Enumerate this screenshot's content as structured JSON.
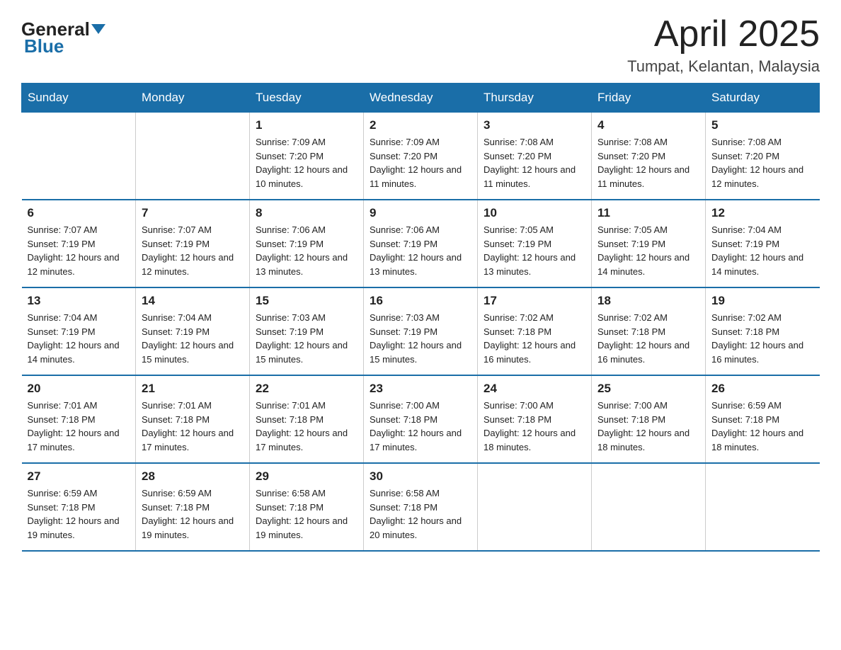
{
  "logo": {
    "general": "General",
    "blue": "Blue"
  },
  "header": {
    "title": "April 2025",
    "subtitle": "Tumpat, Kelantan, Malaysia"
  },
  "days_of_week": [
    "Sunday",
    "Monday",
    "Tuesday",
    "Wednesday",
    "Thursday",
    "Friday",
    "Saturday"
  ],
  "weeks": [
    [
      {
        "day": "",
        "info": ""
      },
      {
        "day": "",
        "info": ""
      },
      {
        "day": "1",
        "info": "Sunrise: 7:09 AM\nSunset: 7:20 PM\nDaylight: 12 hours and 10 minutes."
      },
      {
        "day": "2",
        "info": "Sunrise: 7:09 AM\nSunset: 7:20 PM\nDaylight: 12 hours and 11 minutes."
      },
      {
        "day": "3",
        "info": "Sunrise: 7:08 AM\nSunset: 7:20 PM\nDaylight: 12 hours and 11 minutes."
      },
      {
        "day": "4",
        "info": "Sunrise: 7:08 AM\nSunset: 7:20 PM\nDaylight: 12 hours and 11 minutes."
      },
      {
        "day": "5",
        "info": "Sunrise: 7:08 AM\nSunset: 7:20 PM\nDaylight: 12 hours and 12 minutes."
      }
    ],
    [
      {
        "day": "6",
        "info": "Sunrise: 7:07 AM\nSunset: 7:19 PM\nDaylight: 12 hours and 12 minutes."
      },
      {
        "day": "7",
        "info": "Sunrise: 7:07 AM\nSunset: 7:19 PM\nDaylight: 12 hours and 12 minutes."
      },
      {
        "day": "8",
        "info": "Sunrise: 7:06 AM\nSunset: 7:19 PM\nDaylight: 12 hours and 13 minutes."
      },
      {
        "day": "9",
        "info": "Sunrise: 7:06 AM\nSunset: 7:19 PM\nDaylight: 12 hours and 13 minutes."
      },
      {
        "day": "10",
        "info": "Sunrise: 7:05 AM\nSunset: 7:19 PM\nDaylight: 12 hours and 13 minutes."
      },
      {
        "day": "11",
        "info": "Sunrise: 7:05 AM\nSunset: 7:19 PM\nDaylight: 12 hours and 14 minutes."
      },
      {
        "day": "12",
        "info": "Sunrise: 7:04 AM\nSunset: 7:19 PM\nDaylight: 12 hours and 14 minutes."
      }
    ],
    [
      {
        "day": "13",
        "info": "Sunrise: 7:04 AM\nSunset: 7:19 PM\nDaylight: 12 hours and 14 minutes."
      },
      {
        "day": "14",
        "info": "Sunrise: 7:04 AM\nSunset: 7:19 PM\nDaylight: 12 hours and 15 minutes."
      },
      {
        "day": "15",
        "info": "Sunrise: 7:03 AM\nSunset: 7:19 PM\nDaylight: 12 hours and 15 minutes."
      },
      {
        "day": "16",
        "info": "Sunrise: 7:03 AM\nSunset: 7:19 PM\nDaylight: 12 hours and 15 minutes."
      },
      {
        "day": "17",
        "info": "Sunrise: 7:02 AM\nSunset: 7:18 PM\nDaylight: 12 hours and 16 minutes."
      },
      {
        "day": "18",
        "info": "Sunrise: 7:02 AM\nSunset: 7:18 PM\nDaylight: 12 hours and 16 minutes."
      },
      {
        "day": "19",
        "info": "Sunrise: 7:02 AM\nSunset: 7:18 PM\nDaylight: 12 hours and 16 minutes."
      }
    ],
    [
      {
        "day": "20",
        "info": "Sunrise: 7:01 AM\nSunset: 7:18 PM\nDaylight: 12 hours and 17 minutes."
      },
      {
        "day": "21",
        "info": "Sunrise: 7:01 AM\nSunset: 7:18 PM\nDaylight: 12 hours and 17 minutes."
      },
      {
        "day": "22",
        "info": "Sunrise: 7:01 AM\nSunset: 7:18 PM\nDaylight: 12 hours and 17 minutes."
      },
      {
        "day": "23",
        "info": "Sunrise: 7:00 AM\nSunset: 7:18 PM\nDaylight: 12 hours and 17 minutes."
      },
      {
        "day": "24",
        "info": "Sunrise: 7:00 AM\nSunset: 7:18 PM\nDaylight: 12 hours and 18 minutes."
      },
      {
        "day": "25",
        "info": "Sunrise: 7:00 AM\nSunset: 7:18 PM\nDaylight: 12 hours and 18 minutes."
      },
      {
        "day": "26",
        "info": "Sunrise: 6:59 AM\nSunset: 7:18 PM\nDaylight: 12 hours and 18 minutes."
      }
    ],
    [
      {
        "day": "27",
        "info": "Sunrise: 6:59 AM\nSunset: 7:18 PM\nDaylight: 12 hours and 19 minutes."
      },
      {
        "day": "28",
        "info": "Sunrise: 6:59 AM\nSunset: 7:18 PM\nDaylight: 12 hours and 19 minutes."
      },
      {
        "day": "29",
        "info": "Sunrise: 6:58 AM\nSunset: 7:18 PM\nDaylight: 12 hours and 19 minutes."
      },
      {
        "day": "30",
        "info": "Sunrise: 6:58 AM\nSunset: 7:18 PM\nDaylight: 12 hours and 20 minutes."
      },
      {
        "day": "",
        "info": ""
      },
      {
        "day": "",
        "info": ""
      },
      {
        "day": "",
        "info": ""
      }
    ]
  ]
}
